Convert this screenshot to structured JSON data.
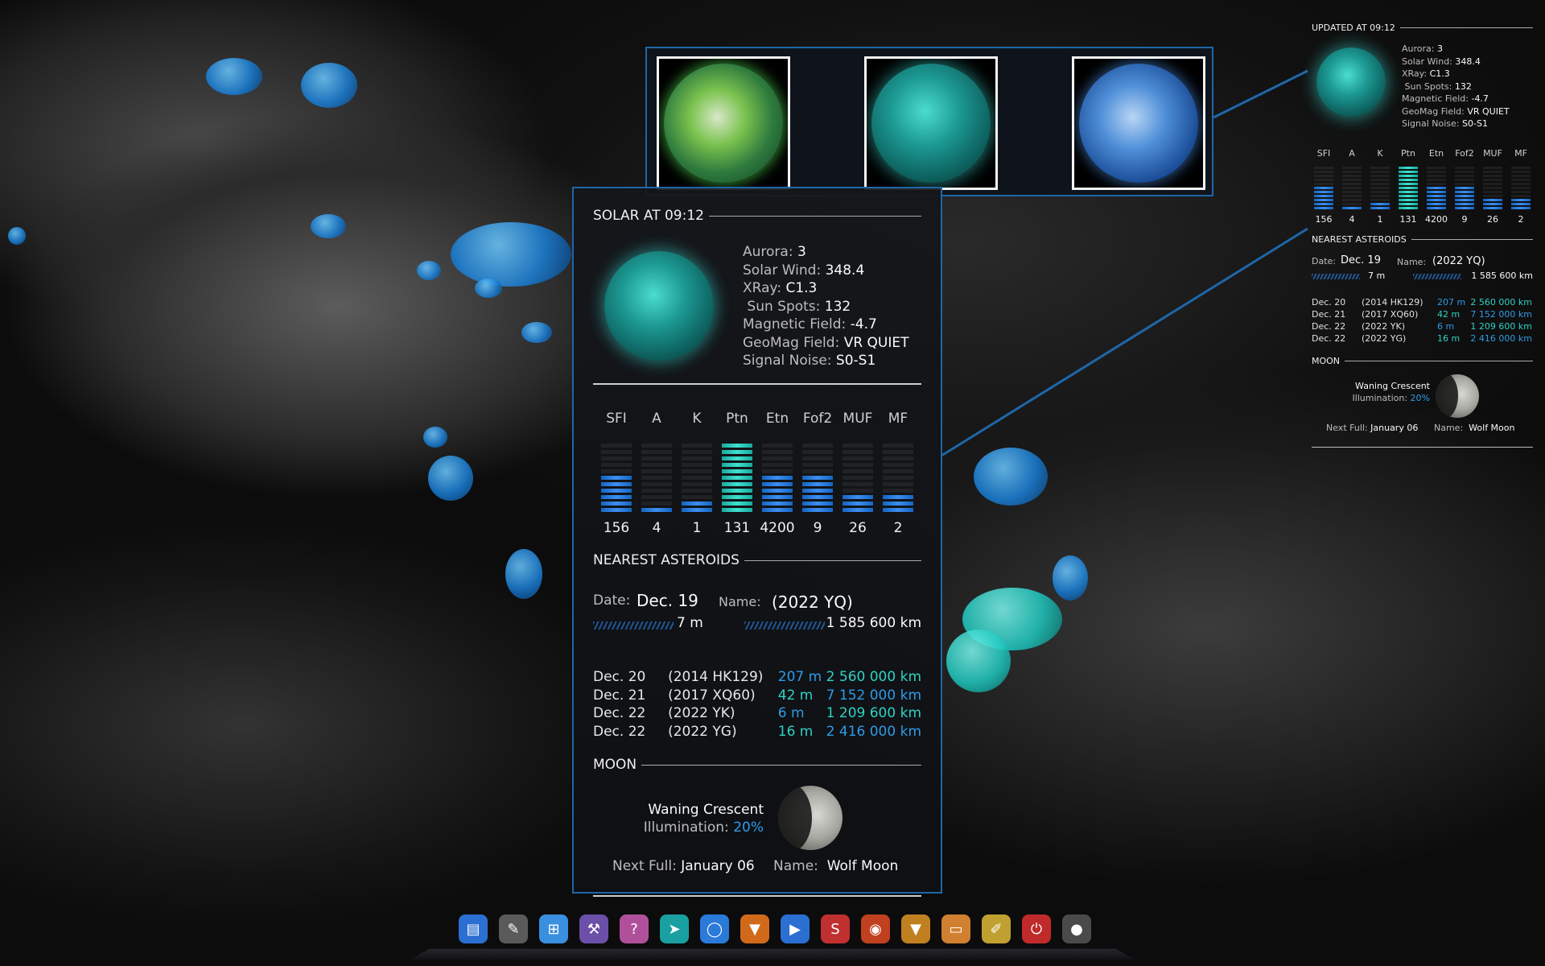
{
  "solar": {
    "title": "SOLAR AT 09:12",
    "stats": [
      {
        "label": "Aurora:",
        "value": "3"
      },
      {
        "label": "Solar Wind:",
        "value": "348.4"
      },
      {
        "label": "XRay:",
        "value": "C1.3"
      },
      {
        "label": "Sun Spots:",
        "value": "132"
      },
      {
        "label": "Magnetic Field:",
        "value": "-4.7"
      },
      {
        "label": "GeoMag Field:",
        "value": "VR QUIET"
      },
      {
        "label": "Signal Noise:",
        "value": "S0-S1"
      }
    ],
    "bands": [
      {
        "label": "SFI",
        "value": "156",
        "level": 0.55,
        "color": "#2a84e8"
      },
      {
        "label": "A",
        "value": "4",
        "level": 0.07,
        "color": "#2a84e8"
      },
      {
        "label": "K",
        "value": "1",
        "level": 0.14,
        "color": "#2a84e8"
      },
      {
        "label": "Ptn",
        "value": "131",
        "level": 1.0,
        "color": "#2fd2c4"
      },
      {
        "label": "Etn",
        "value": "4200",
        "level": 0.5,
        "color": "#2a84e8"
      },
      {
        "label": "Fof2",
        "value": "9",
        "level": 0.5,
        "color": "#2a84e8"
      },
      {
        "label": "MUF",
        "value": "26",
        "level": 0.28,
        "color": "#2a84e8"
      },
      {
        "label": "MF",
        "value": "2",
        "level": 0.28,
        "color": "#2a84e8"
      }
    ]
  },
  "asteroids": {
    "title": "NEAREST ASTEROIDS",
    "date_label": "Date:",
    "date": "Dec. 19",
    "name_label": "Name:",
    "name": "(2022 YQ)",
    "size": "7 m",
    "distance": "1 585 600 km",
    "rows": [
      {
        "date": "Dec. 20",
        "name": "(2014 HK129)",
        "size": "207 m",
        "distance": "2 560 000 km"
      },
      {
        "date": "Dec. 21",
        "name": "(2017 XQ60)",
        "size": "42 m",
        "distance": "7 152 000 km"
      },
      {
        "date": "Dec. 22",
        "name": "(2022 YK)",
        "size": "6 m",
        "distance": "1 209 600 km"
      },
      {
        "date": "Dec. 22",
        "name": "(2022 YG)",
        "size": "16 m",
        "distance": "2 416 000 km"
      }
    ]
  },
  "moon": {
    "title": "MOON",
    "phase": "Waning Crescent",
    "illumination_label": "Illumination:",
    "illumination": "20%",
    "next_full_label": "Next Full:",
    "next_full": "January 06",
    "name_label": "Name:",
    "name": "Wolf Moon"
  },
  "right_widget": {
    "updated": "UPDATED AT 09:12"
  },
  "colors": {
    "accent_blue": "#1f66a8",
    "value_blue": "#2e9be8",
    "value_teal": "#2fd2c4"
  },
  "dock": {
    "icons": [
      "files-icon",
      "gimp-icon",
      "windows-icon",
      "gnome-builder-icon",
      "peek-icon",
      "telegram-icon",
      "signal-icon",
      "brave-icon",
      "media-player-icon",
      "scribus-icon",
      "rss-icon",
      "brave-beta-icon",
      "folder-icon",
      "text-editor-icon",
      "power-icon",
      "trash-icon"
    ]
  }
}
